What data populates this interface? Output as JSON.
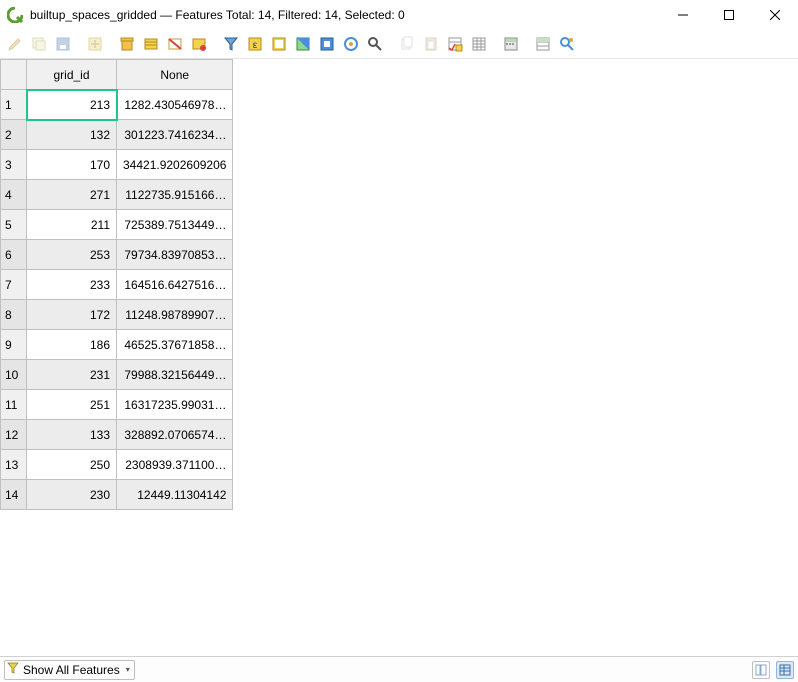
{
  "window": {
    "title": "builtup_spaces_gridded — Features Total: 14, Filtered: 14, Selected: 0"
  },
  "toolbar": {
    "icons": [
      {
        "name": "pencil-icon",
        "disabled": true
      },
      {
        "name": "multiedit-icon",
        "disabled": true
      },
      {
        "name": "save-edits-icon",
        "disabled": true
      },
      {
        "name": "sep"
      },
      {
        "name": "add-feature-icon",
        "disabled": true
      },
      {
        "name": "sep"
      },
      {
        "name": "delete-selected-icon",
        "disabled": false
      },
      {
        "name": "cut-icon",
        "disabled": false
      },
      {
        "name": "copy-icon",
        "disabled": false
      },
      {
        "name": "paste-icon",
        "disabled": false
      },
      {
        "name": "sep"
      },
      {
        "name": "filter-icon",
        "disabled": false
      },
      {
        "name": "select-by-expression-icon",
        "disabled": false
      },
      {
        "name": "select-all-icon",
        "disabled": false
      },
      {
        "name": "invert-selection-icon",
        "disabled": false
      },
      {
        "name": "deselect-all-icon",
        "disabled": false
      },
      {
        "name": "filter-selected-icon",
        "disabled": false
      },
      {
        "name": "zoom-to-selected-icon",
        "disabled": false
      },
      {
        "name": "sep"
      },
      {
        "name": "copy-cell-icon",
        "disabled": true
      },
      {
        "name": "paste-cell-icon",
        "disabled": true
      },
      {
        "name": "new-field-icon",
        "disabled": false
      },
      {
        "name": "delete-field-icon",
        "disabled": false
      },
      {
        "name": "sep"
      },
      {
        "name": "field-calculator-icon",
        "disabled": false
      },
      {
        "name": "sep"
      },
      {
        "name": "conditional-format-icon",
        "disabled": false
      },
      {
        "name": "actions-icon",
        "disabled": false
      }
    ]
  },
  "table": {
    "columns": [
      "grid_id",
      "None"
    ],
    "rows": [
      {
        "n": "1",
        "grid_id": "213",
        "none": "1282.430546978…"
      },
      {
        "n": "2",
        "grid_id": "132",
        "none": "301223.7416234…"
      },
      {
        "n": "3",
        "grid_id": "170",
        "none": "34421.9202609206"
      },
      {
        "n": "4",
        "grid_id": "271",
        "none": "1122735.915166…"
      },
      {
        "n": "5",
        "grid_id": "211",
        "none": "725389.7513449…"
      },
      {
        "n": "6",
        "grid_id": "253",
        "none": "79734.83970853…"
      },
      {
        "n": "7",
        "grid_id": "233",
        "none": "164516.6427516…"
      },
      {
        "n": "8",
        "grid_id": "172",
        "none": "11248.98789907…"
      },
      {
        "n": "9",
        "grid_id": "186",
        "none": "46525.37671858…"
      },
      {
        "n": "10",
        "grid_id": "231",
        "none": "79988.32156449…"
      },
      {
        "n": "11",
        "grid_id": "251",
        "none": "16317235.99031…"
      },
      {
        "n": "12",
        "grid_id": "133",
        "none": "328892.0706574…"
      },
      {
        "n": "13",
        "grid_id": "250",
        "none": "2308939.371100…"
      },
      {
        "n": "14",
        "grid_id": "230",
        "none": "12449.11304142"
      }
    ],
    "selected_cell": {
      "row": 0,
      "col": 0
    }
  },
  "statusbar": {
    "filter_label": "Show All Features"
  }
}
